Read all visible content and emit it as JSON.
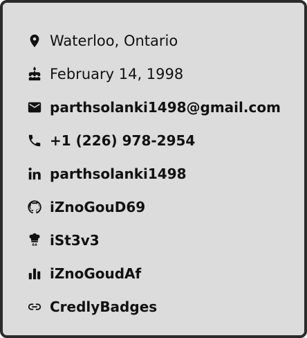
{
  "colors": {
    "card_background": "#dcdcdc",
    "card_border": "#2b2b2b",
    "text": "#111111"
  },
  "contact": {
    "location": {
      "icon": "map-pin-icon",
      "text": "Waterloo, Ontario"
    },
    "birthday": {
      "icon": "cake-icon",
      "text": "February 14, 1998"
    },
    "email": {
      "icon": "envelope-icon",
      "text": "parthsolanki1498@gmail.com"
    },
    "phone": {
      "icon": "phone-icon",
      "text": "+1 (226) 978-2954"
    },
    "linkedin": {
      "icon": "linkedin-icon",
      "text": "parthsolanki1498"
    },
    "github": {
      "icon": "github-icon",
      "text": "iZnoGouD69"
    },
    "chef": {
      "icon": "chef-icon",
      "text": "iSt3v3"
    },
    "stats": {
      "icon": "bar-chart-icon",
      "text": "iZnoGoudAf"
    },
    "credly": {
      "icon": "link-icon",
      "text": "CredlyBadges"
    }
  }
}
